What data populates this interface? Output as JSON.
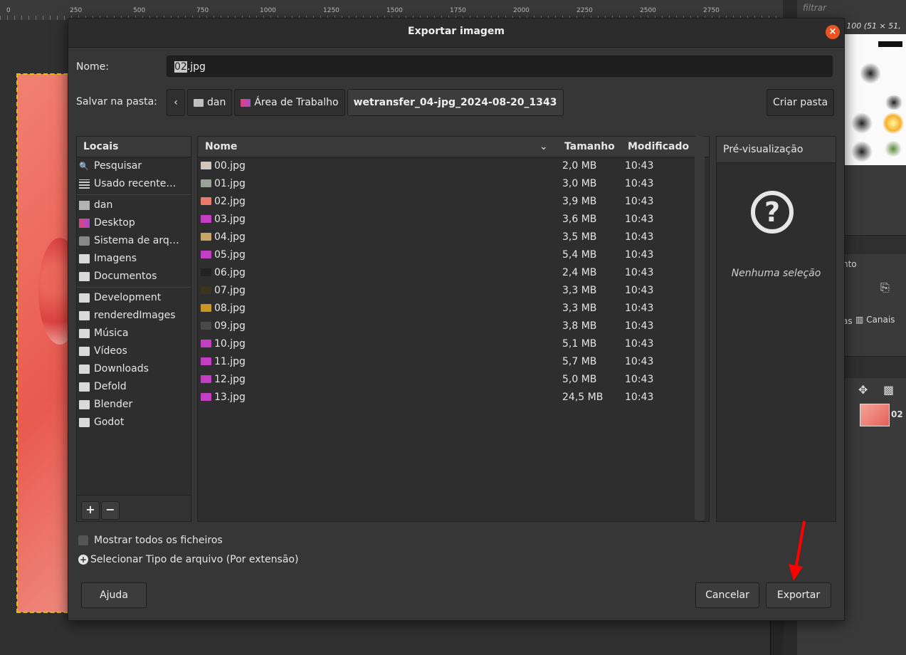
{
  "background": {
    "ruler_ticks": [
      "0",
      "250",
      "500",
      "750",
      "1000",
      "1250",
      "1500",
      "1750",
      "2000",
      "2250",
      "2500",
      "2750"
    ],
    "filter_placeholder": "filtrar",
    "brush_title": "s 100 (51 × 51,",
    "right_text_1": "nto",
    "right_tab_canais": "Canais",
    "right_tab_prefix": "as",
    "layer_name": "02"
  },
  "dialog": {
    "title": "Exportar imagem",
    "name_label": "Nome:",
    "name_value_selected": "02",
    "name_value_rest": ".jpg",
    "folder_label": "Salvar na pasta:",
    "path": [
      "dan",
      "Área de Trabalho",
      "wetransfer_04-jpg_2024-08-20_1343"
    ],
    "create_folder": "Criar pasta",
    "places_header": "Locais",
    "places": [
      {
        "label": "Pesquisar",
        "icon": "search-icon"
      },
      {
        "label": "Usado recente…",
        "icon": "recent-icon"
      },
      {
        "label": "dan",
        "icon": "home-icon"
      },
      {
        "label": "Desktop",
        "icon": "desktop-icon"
      },
      {
        "label": "Sistema de arq…",
        "icon": "disk-icon"
      },
      {
        "label": "Imagens",
        "icon": "folder-icon"
      },
      {
        "label": "Documentos",
        "icon": "folder-icon"
      },
      {
        "label": "Development",
        "icon": "folder-icon"
      },
      {
        "label": "renderedImages",
        "icon": "folder-icon"
      },
      {
        "label": "Música",
        "icon": "folder-icon"
      },
      {
        "label": "Vídeos",
        "icon": "folder-icon"
      },
      {
        "label": "Downloads",
        "icon": "folder-icon"
      },
      {
        "label": "Defold",
        "icon": "folder-icon"
      },
      {
        "label": "Blender",
        "icon": "folder-icon"
      },
      {
        "label": "Godot",
        "icon": "folder-icon"
      }
    ],
    "columns": {
      "name": "Nome",
      "size": "Tamanho",
      "modified": "Modificado"
    },
    "files": [
      {
        "name": "00.jpg",
        "size": "2,0 MB",
        "modified": "10:43",
        "thumb": "#cfc7bd"
      },
      {
        "name": "01.jpg",
        "size": "3,0 MB",
        "modified": "10:43",
        "thumb": "#9aa39a"
      },
      {
        "name": "02.jpg",
        "size": "3,9 MB",
        "modified": "10:43",
        "thumb": "#e97a6e"
      },
      {
        "name": "03.jpg",
        "size": "3,6 MB",
        "modified": "10:43",
        "thumb": "#c13fc0"
      },
      {
        "name": "04.jpg",
        "size": "3,5 MB",
        "modified": "10:43",
        "thumb": "#c9a56a"
      },
      {
        "name": "05.jpg",
        "size": "5,4 MB",
        "modified": "10:43",
        "thumb": "#c13fc0"
      },
      {
        "name": "06.jpg",
        "size": "2,4 MB",
        "modified": "10:43",
        "thumb": "#222222"
      },
      {
        "name": "07.jpg",
        "size": "3,3 MB",
        "modified": "10:43",
        "thumb": "#3a3520"
      },
      {
        "name": "08.jpg",
        "size": "3,3 MB",
        "modified": "10:43",
        "thumb": "#c9962a"
      },
      {
        "name": "09.jpg",
        "size": "3,8 MB",
        "modified": "10:43",
        "thumb": "#4a4a4a"
      },
      {
        "name": "10.jpg",
        "size": "5,1 MB",
        "modified": "10:43",
        "thumb": "#c13fc0"
      },
      {
        "name": "11.jpg",
        "size": "5,7 MB",
        "modified": "10:43",
        "thumb": "#c13fc0"
      },
      {
        "name": "12.jpg",
        "size": "5,0 MB",
        "modified": "10:43",
        "thumb": "#c13fc0"
      },
      {
        "name": "13.jpg",
        "size": "24,5 MB",
        "modified": "10:43",
        "thumb": "#c13fc0"
      }
    ],
    "preview_header": "Pré-visualização",
    "preview_empty": "Nenhuma seleção",
    "show_all_files": "Mostrar todos os ficheiros",
    "select_file_type": "Selecionar Tipo de arquivo (Por extensão)",
    "help_button": "Ajuda",
    "cancel_button": "Cancelar",
    "export_button": "Exportar"
  },
  "colors": {
    "accent_close": "#e95420",
    "annotation_arrow": "#ff0000"
  }
}
